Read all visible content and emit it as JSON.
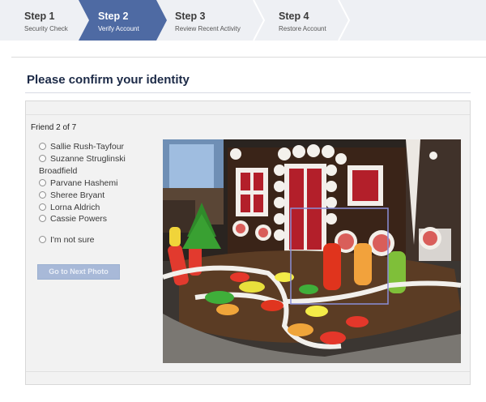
{
  "steps": [
    {
      "title": "Step 1",
      "subtitle": "Security Check"
    },
    {
      "title": "Step 2",
      "subtitle": "Verify Account"
    },
    {
      "title": "Step 3",
      "subtitle": "Review Recent Activity"
    },
    {
      "title": "Step 4",
      "subtitle": "Restore Account"
    }
  ],
  "colors": {
    "active_step": "#4e6aa3",
    "inactive_step": "#eef0f4",
    "title": "#1c2a47",
    "button": "#a8b9d8"
  },
  "page_title": "Please confirm your identity",
  "counter": "Friend 2 of 7",
  "options": [
    {
      "label": "Sallie Rush-Tayfour"
    },
    {
      "label": "Suzanne Struglinski"
    },
    {
      "label": "Broadfield"
    },
    {
      "label": "Parvane Hashemi"
    },
    {
      "label": "Sheree Bryant"
    },
    {
      "label": "Lorna Aldrich"
    },
    {
      "label": "Cassie Powers"
    },
    {
      "label": "I'm not sure"
    }
  ],
  "next_button": "Go to Next Photo",
  "photo_icon": "gingerbread-house-photo",
  "radio_icon": "radio-icon"
}
